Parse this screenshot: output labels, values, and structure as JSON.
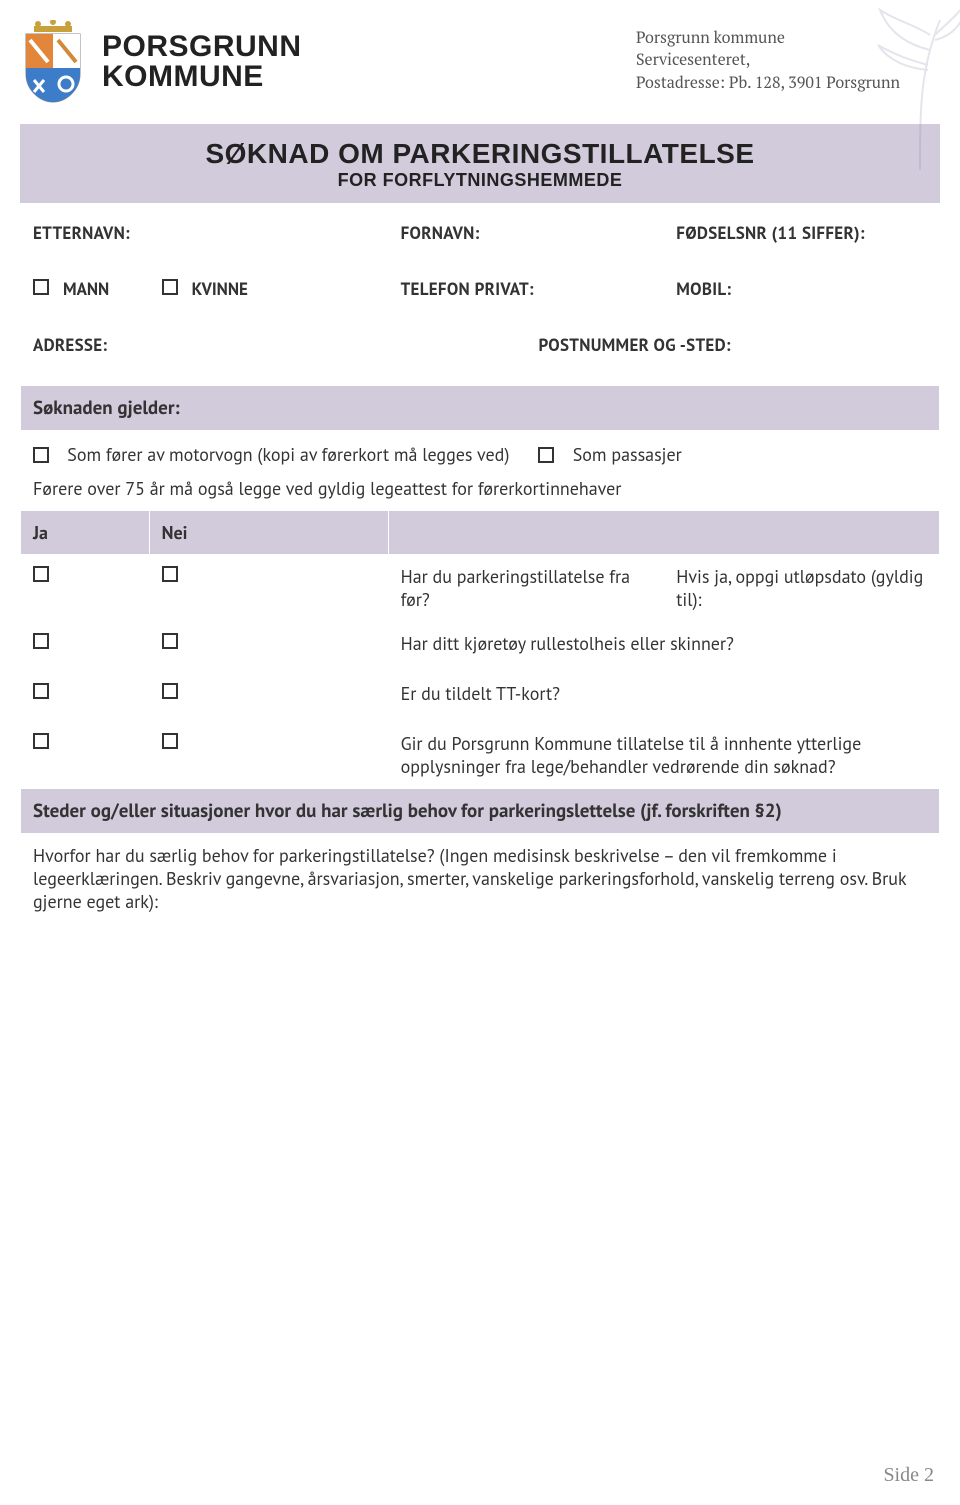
{
  "sender": {
    "line1": "Porsgrunn kommune",
    "line2": "Servicesenteret,",
    "line3": "Postadresse: Pb. 128, 3901 Porsgrunn"
  },
  "logo": {
    "line1": "PORSGRUNN",
    "line2": "KOMMUNE"
  },
  "title": "SØKNAD OM PARKERINGSTILLATELSE",
  "subtitle": "FOR FORFLYTNINGSHEMMEDE",
  "fields": {
    "etternavn": "ETTERNAVN:",
    "fornavn": "FORNAVN:",
    "fodselsnr": "FØDSELSNR  (11 SIFFER):",
    "mann": "MANN",
    "kvinne": "KVINNE",
    "telefon_privat": "TELEFON PRIVAT:",
    "mobil": "MOBIL:",
    "adresse": "ADRESSE:",
    "postnummer": "POSTNUMMER OG -STED:"
  },
  "soknaden_gjelder": {
    "heading": "Søknaden gjelder:",
    "opt_forer": "Som fører av motorvogn (kopi av førerkort må legges ved)",
    "opt_passasjer": "Som passasjer",
    "note_75": "Førere over 75 år må også legge ved gyldig legeattest for førerkortinnehaver"
  },
  "janei": {
    "ja": "Ja",
    "nei": "Nei",
    "q1": "Har du parkeringstillatelse fra før?",
    "q1_followup": "Hvis ja, oppgi utløpsdato (gyldig til):",
    "q2": "Har ditt kjøretøy rullestolheis eller skinner?",
    "q3": "Er du tildelt TT-kort?",
    "q4": "Gir du Porsgrunn Kommune tillatelse til å innhente ytterlige opplysninger fra lege/behandler vedrørende din søknad?"
  },
  "steder": {
    "heading": "Steder og/eller situasjoner hvor du har særlig behov for parkeringslettelse (jf. forskriften §2)",
    "prompt": "Hvorfor har du særlig behov for parkeringstillatelse? (Ingen medisinsk beskrivelse – den vil fremkomme i legeerklæringen. Beskriv gangevne, årsvariasjon, smerter, vanskelige parkeringsforhold, vanskelig terreng osv. Bruk gjerne eget ark):"
  },
  "page_number": "Side 2"
}
